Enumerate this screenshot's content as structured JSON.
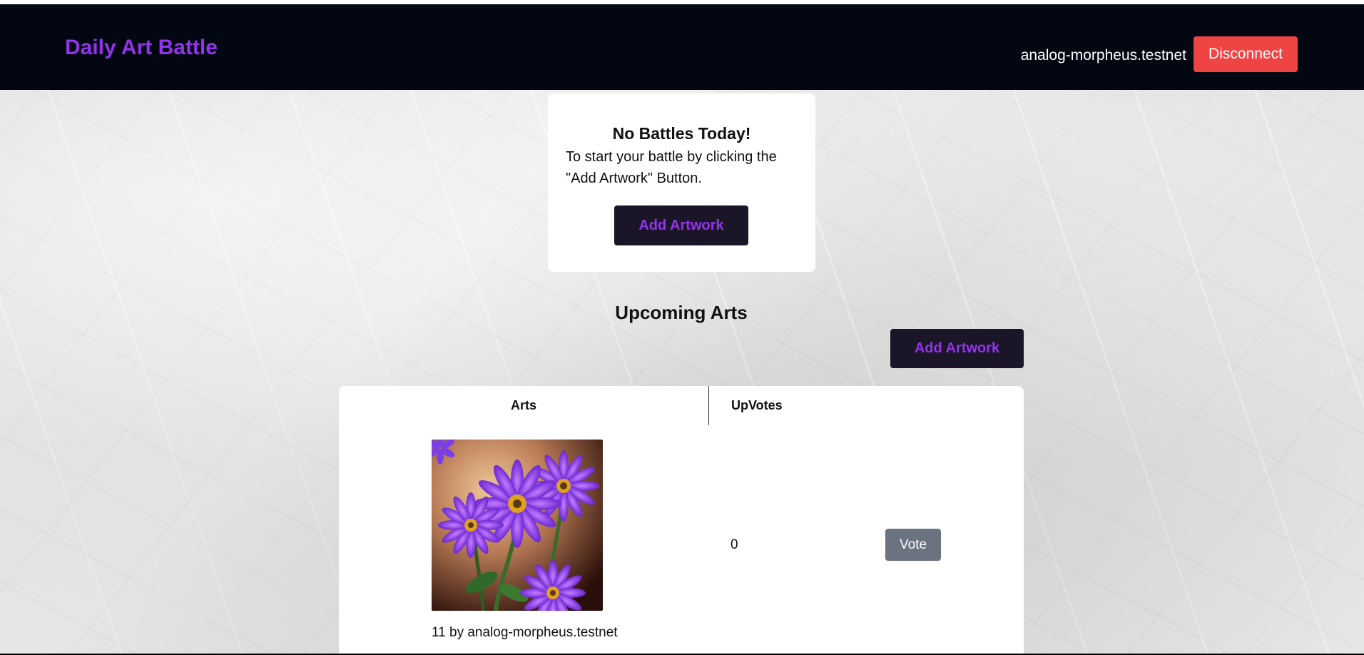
{
  "navbar": {
    "brand": "Daily Art Battle",
    "account": "analog-morpheus.testnet",
    "disconnect_label": "Disconnect"
  },
  "notice": {
    "title": "No Battles Today!",
    "text": "To start your battle by clicking the \"Add Artwork\" Button.",
    "add_label": "Add Artwork"
  },
  "upcoming": {
    "title": "Upcoming Arts",
    "add_label": "Add Artwork",
    "columns": [
      "Arts",
      "UpVotes"
    ],
    "rows": [
      {
        "caption": "11 by analog-morpheus.testnet",
        "upvotes": "0",
        "vote_label": "Vote",
        "image_icon": "purple-daisy-flowers-image"
      }
    ]
  },
  "colors": {
    "navbar_bg": "#030712",
    "brand": "#9333ea",
    "disconnect_bg": "#ef4444",
    "dark_button_bg": "#1a1628",
    "vote_bg": "#6b7280"
  }
}
